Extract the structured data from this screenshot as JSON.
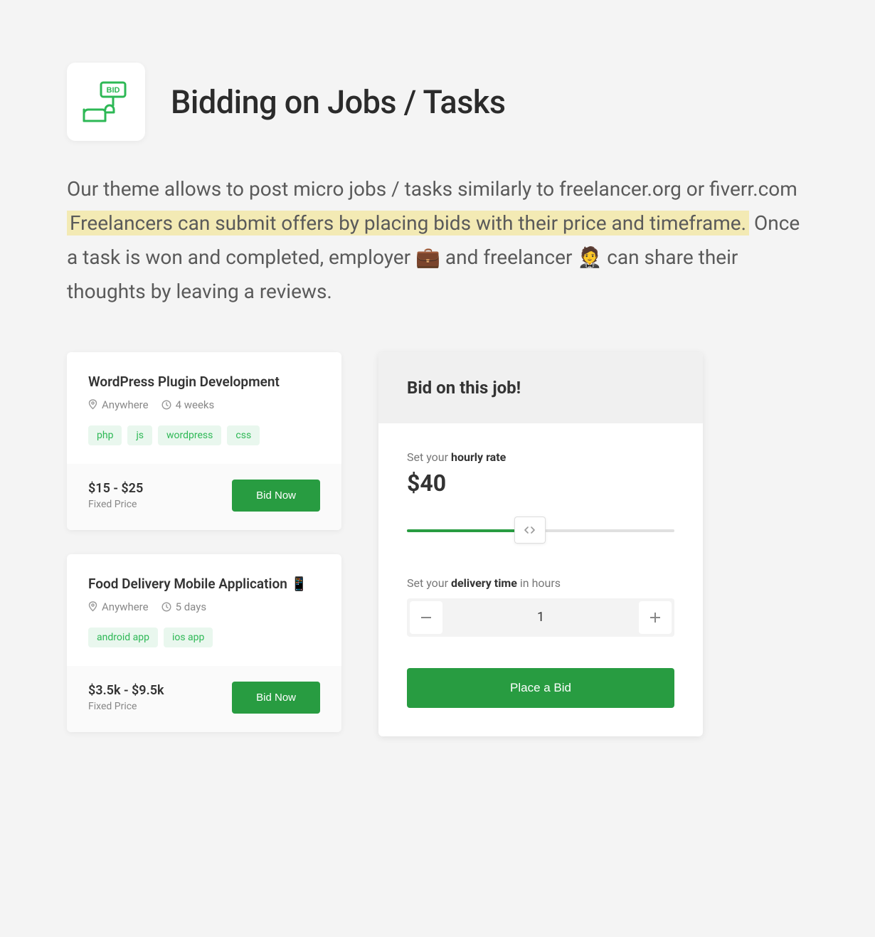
{
  "header": {
    "title": "Bidding on Jobs / Tasks"
  },
  "intro": {
    "part1": "Our theme allows to post micro jobs / tasks similarly to freelancer.org or fiverr.com ",
    "highlight": " Freelancers can submit offers by placing bids with their price and timeframe.",
    "part2": " Once a task is won and completed, employer ",
    "part3": " and  freelancer ",
    "part4": " can share their thoughts by leaving a reviews."
  },
  "jobs": [
    {
      "title": "WordPress Plugin Development",
      "location": "Anywhere",
      "duration": "4 weeks",
      "tags": [
        "php",
        "js",
        "wordpress",
        "css"
      ],
      "price": "$15 - $25",
      "price_type": "Fixed Price",
      "bid_label": "Bid Now"
    },
    {
      "title": "Food Delivery Mobile Application 📱",
      "location": "Anywhere",
      "duration": "5 days",
      "tags": [
        "android app",
        "ios app"
      ],
      "price": "$3.5k - $9.5k",
      "price_type": "Fixed Price",
      "bid_label": "Bid Now"
    }
  ],
  "bid_panel": {
    "heading": "Bid on this job!",
    "rate_label_pre": "Set your ",
    "rate_label_strong": "hourly rate",
    "rate_value": "$40",
    "delivery_label_pre": "Set your ",
    "delivery_label_strong": "delivery time",
    "delivery_label_post": " in hours",
    "delivery_value": "1",
    "submit_label": "Place a Bid"
  }
}
